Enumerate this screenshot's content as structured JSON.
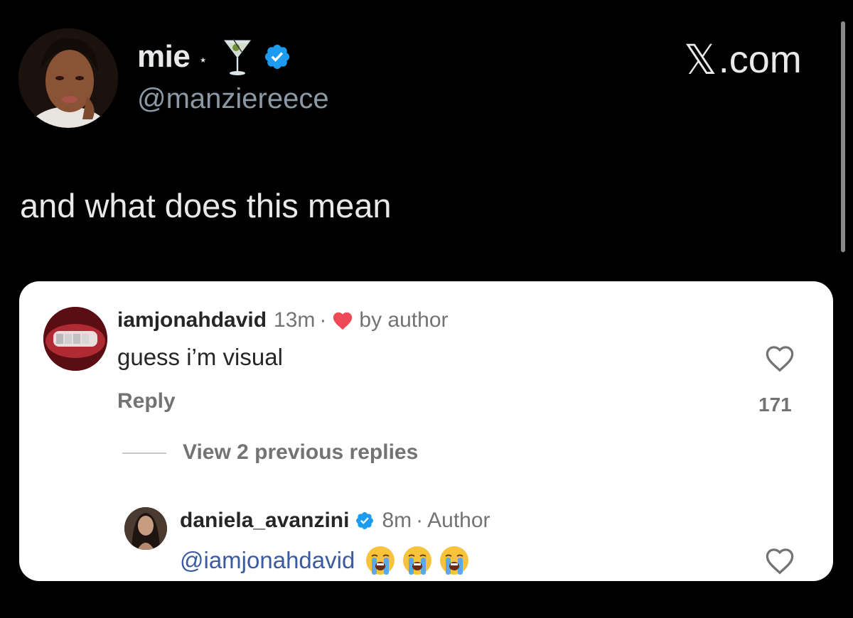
{
  "tweet": {
    "display_name": "mie",
    "name_separator": "⋆",
    "martini_emoji": "🍸",
    "handle": "@manziereece",
    "site_x": "𝕏",
    "site_suffix": ".com",
    "text": "and what does this mean",
    "verified": true
  },
  "embedded_comments": {
    "comment": {
      "username": "iamjonahdavid",
      "time": "13m",
      "liked_by": "by author",
      "text": "guess i’m visual",
      "reply_label": "Reply",
      "like_count": "171"
    },
    "view_replies_label": "View 2 previous replies",
    "reply": {
      "username": "daniela_avanzini",
      "time": "8m",
      "role": "Author",
      "mention": "@iamjonahdavid",
      "emoji": [
        "😭",
        "😭",
        "😭"
      ],
      "verified": true
    }
  },
  "colors": {
    "background": "#000000",
    "verified_blue": "#1d9bf0",
    "heart_red": "#ed4956",
    "card_bg": "#ffffff"
  },
  "icons": [
    "martini-icon",
    "verified-badge-icon",
    "heart-icon",
    "heart-outline-icon",
    "crying-face-icon"
  ]
}
